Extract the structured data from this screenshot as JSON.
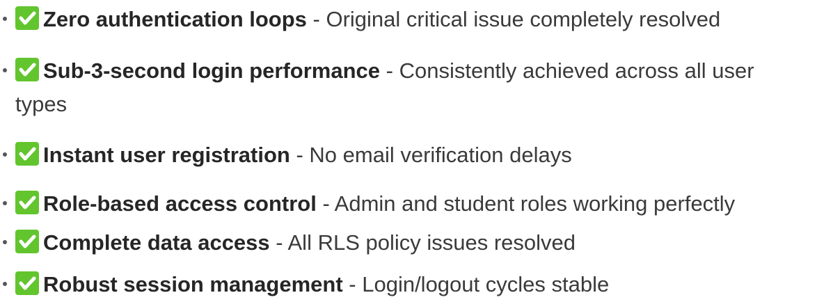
{
  "items": [
    {
      "title": "Zero authentication loops",
      "sep": " - ",
      "desc": "Original critical issue completely resolved"
    },
    {
      "title": "Sub-3-second login performance",
      "sep": " - ",
      "desc": "Consistently achieved across all user types"
    },
    {
      "title": "Instant user registration",
      "sep": " - ",
      "desc": "No email verification delays"
    },
    {
      "title": "Role-based access control",
      "sep": " - ",
      "desc": "Admin and student roles working perfectly"
    },
    {
      "title": "Complete data access",
      "sep": " - ",
      "desc": "All RLS policy issues resolved"
    },
    {
      "title": "Robust session management",
      "sep": " - ",
      "desc": "Login/logout cycles stable"
    }
  ],
  "icon": "check-mark-button-icon",
  "accent_color": "#62c52e"
}
